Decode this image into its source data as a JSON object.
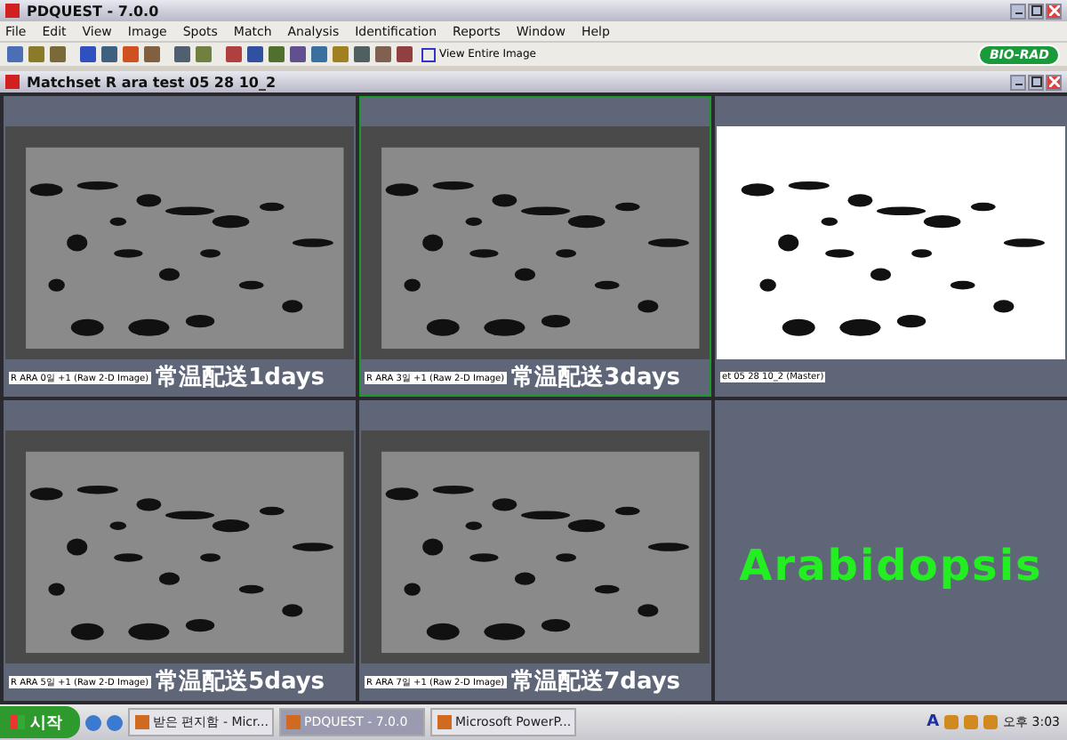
{
  "window": {
    "title": "PDQUEST - 7.0.0"
  },
  "menu": [
    "File",
    "Edit",
    "View",
    "Image",
    "Spots",
    "Match",
    "Analysis",
    "Identification",
    "Reports",
    "Window",
    "Help"
  ],
  "toolbar": {
    "view_button": "View Entire Image",
    "logo": "BIO-RAD"
  },
  "document": {
    "title": "Matchset R ara test 05 28 10_2"
  },
  "panels": [
    {
      "kind": "gel",
      "label": "R ARA 0일 +1 (Raw 2-D Image)",
      "caption": "常温配送1days",
      "selected": false
    },
    {
      "kind": "gel",
      "label": "R ARA 3일 +1 (Raw 2-D Image)",
      "caption": "常温配送3days",
      "selected": true
    },
    {
      "kind": "master",
      "label": "et 05 28 10_2 (Master)",
      "selected": false
    },
    {
      "kind": "gel",
      "label": "R ARA 5일 +1 (Raw 2-D Image)",
      "caption": "常温配送5days",
      "selected": false
    },
    {
      "kind": "gel",
      "label": "R ARA 7일 +1 (Raw 2-D Image)",
      "caption": "常温配送7days",
      "selected": false
    },
    {
      "kind": "text",
      "label": "Arabidopsis",
      "selected": false
    }
  ],
  "taskbar": {
    "start": "시작",
    "tasks": [
      {
        "label": "받은 편지함 - Micr...",
        "selected": false
      },
      {
        "label": "PDQUEST - 7.0.0",
        "selected": true
      },
      {
        "label": "Microsoft PowerP...",
        "selected": false
      }
    ],
    "tray_letter": "A",
    "clock": "오후 3:03"
  }
}
